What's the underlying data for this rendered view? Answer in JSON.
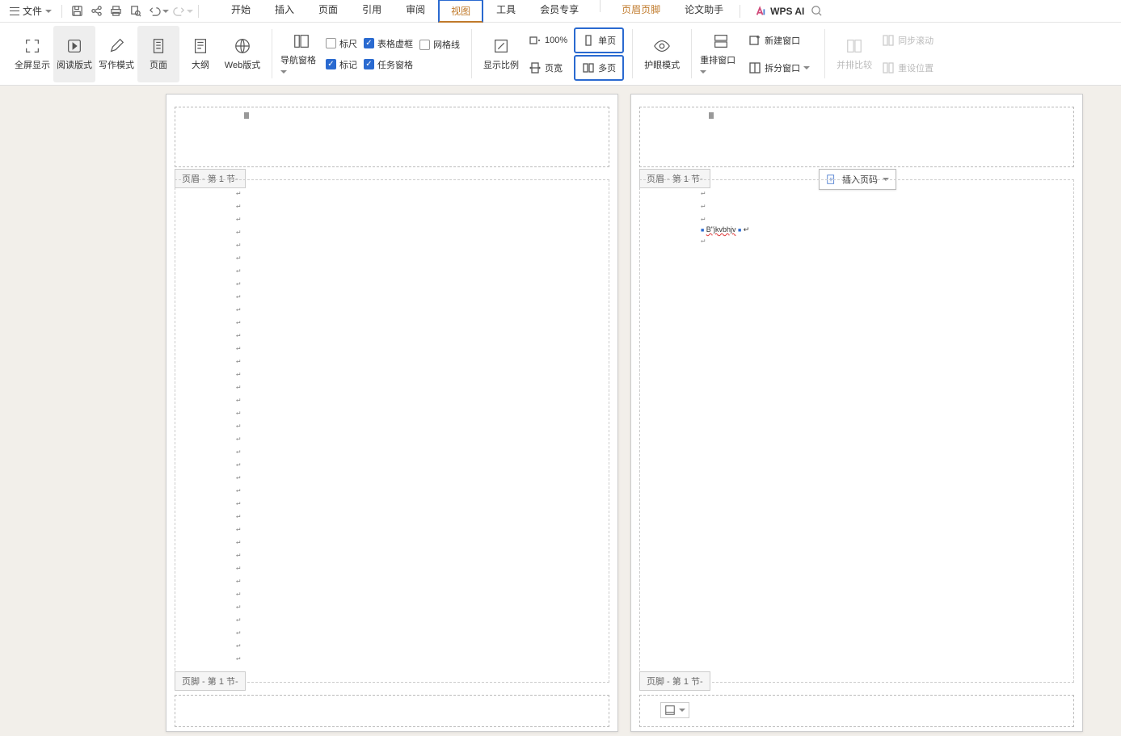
{
  "menubar": {
    "file_label": "文件",
    "tabs": [
      "开始",
      "插入",
      "页面",
      "引用",
      "审阅",
      "视图",
      "工具",
      "会员专享"
    ],
    "hf_tab": "页眉页脚",
    "paper_tab": "论文助手",
    "active_tab": "视图",
    "ai_label": "WPS AI"
  },
  "ribbon": {
    "fullscreen": "全屏显示",
    "read_mode": "阅读版式",
    "write_mode": "写作模式",
    "page_view": "页面",
    "outline": "大纲",
    "web_view": "Web版式",
    "nav_pane": "导航窗格",
    "ruler": "标尺",
    "table_frame": "表格虚框",
    "gridlines": "网格线",
    "markup": "标记",
    "task_pane": "任务窗格",
    "show_ratio": "显示比例",
    "zoom_100": "100%",
    "page_width": "页宽",
    "one_page": "单页",
    "multi_page": "多页",
    "eye_protect": "护眼模式",
    "rearrange": "重排窗口",
    "new_window": "新建窗口",
    "split_window": "拆分窗口",
    "side_by_side": "并排比较",
    "sync_scroll": "同步滚动",
    "reset_pos": "重设位置"
  },
  "doc": {
    "header_tag": "页眉  - 第 1 节-",
    "footer_tag": "页脚  - 第 1 节-",
    "insert_page_no": "插入页码",
    "sample_text": "B\"jkvbhjv"
  }
}
